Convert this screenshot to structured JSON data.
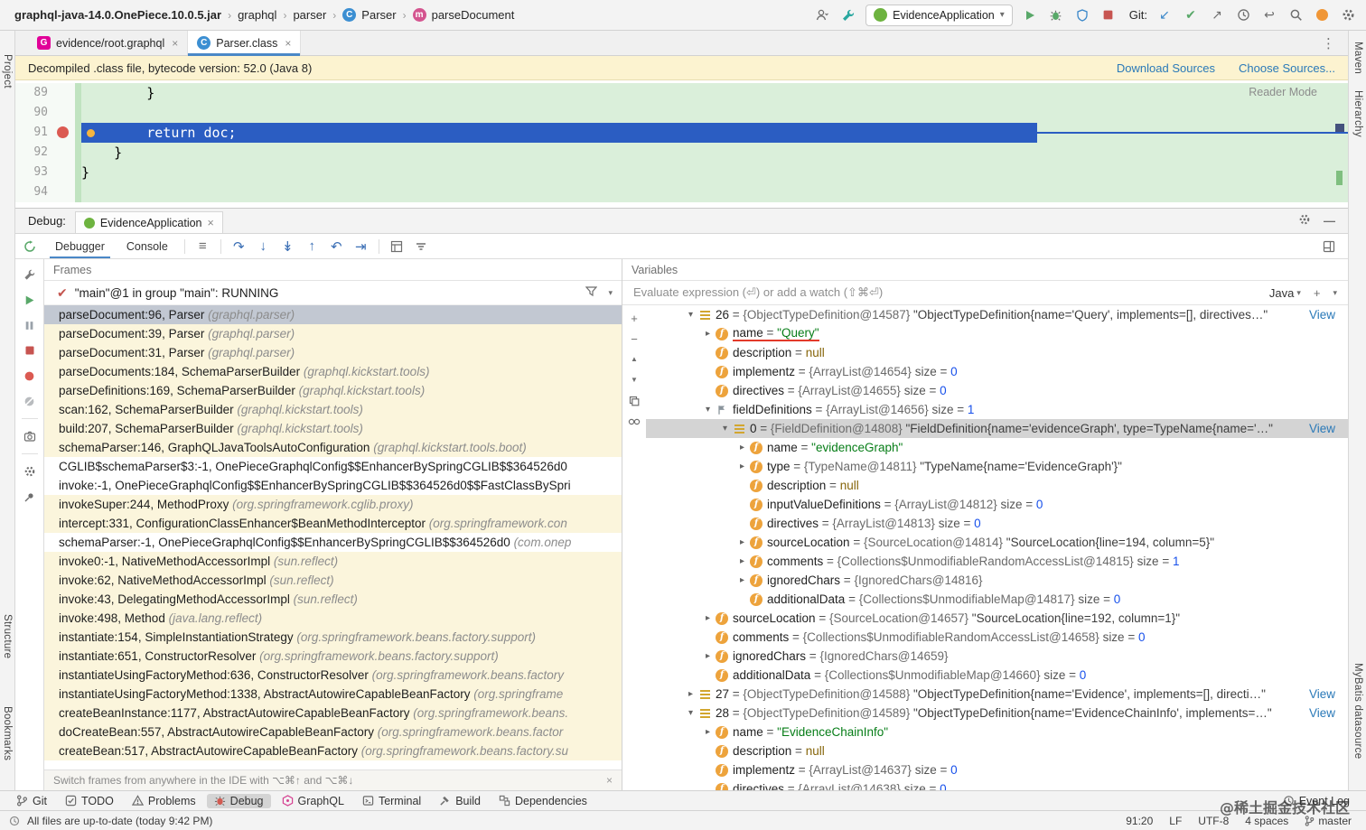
{
  "titlebar": {
    "breadcrumb": [
      {
        "label": "graphql-java-14.0.OnePiece.10.0.5.jar",
        "bold": true
      },
      {
        "label": "graphql"
      },
      {
        "label": "parser"
      },
      {
        "label": "Parser",
        "icon": "class-icon"
      },
      {
        "label": "parseDocument",
        "icon": "method-icon"
      }
    ],
    "run_config_label": "EvidenceApplication",
    "git_label": "Git:"
  },
  "editor_tabs": [
    {
      "label": "evidence/root.graphql",
      "icon": "graphql-file-icon",
      "active": false
    },
    {
      "label": "Parser.class",
      "icon": "class-icon",
      "active": true
    }
  ],
  "banner": {
    "message": "Decompiled .class file, bytecode version: 52.0 (Java 8)",
    "download_link": "Download Sources",
    "choose_link": "Choose Sources..."
  },
  "editor": {
    "reader_mode_label": "Reader Mode",
    "lines": [
      {
        "num": "89",
        "code": "        }"
      },
      {
        "num": "90",
        "code": ""
      },
      {
        "num": "91",
        "code": "        return doc;",
        "exec": true,
        "breakpoint": true
      },
      {
        "num": "92",
        "code": "    }"
      },
      {
        "num": "93",
        "code": "}"
      },
      {
        "num": "94",
        "code": ""
      }
    ]
  },
  "debug": {
    "panel_label": "Debug:",
    "session_tab_label": "EvidenceApplication",
    "tabs": [
      {
        "label": "Debugger",
        "active": true
      },
      {
        "label": "Console",
        "active": false
      }
    ],
    "frames": {
      "title": "Frames",
      "thread_label": "\"main\"@1 in group \"main\": RUNNING",
      "hint": "Switch frames from anywhere in the IDE with ⌥⌘↑ and ⌥⌘↓",
      "items": [
        {
          "text": "parseDocument:96, Parser",
          "pkg": "(graphql.parser)",
          "selected": true
        },
        {
          "text": "parseDocument:39, Parser",
          "pkg": "(graphql.parser)"
        },
        {
          "text": "parseDocument:31, Parser",
          "pkg": "(graphql.parser)"
        },
        {
          "text": "parseDocuments:184, SchemaParserBuilder",
          "pkg": "(graphql.kickstart.tools)"
        },
        {
          "text": "parseDefinitions:169, SchemaParserBuilder",
          "pkg": "(graphql.kickstart.tools)"
        },
        {
          "text": "scan:162, SchemaParserBuilder",
          "pkg": "(graphql.kickstart.tools)"
        },
        {
          "text": "build:207, SchemaParserBuilder",
          "pkg": "(graphql.kickstart.tools)"
        },
        {
          "text": "schemaParser:146, GraphQLJavaToolsAutoConfiguration",
          "pkg": "(graphql.kickstart.tools.boot)"
        },
        {
          "text": "CGLIB$schemaParser$3:-1, OnePieceGraphqlConfig$$EnhancerBySpringCGLIB$$364526d0",
          "pkg": "",
          "project": true
        },
        {
          "text": "invoke:-1, OnePieceGraphqlConfig$$EnhancerBySpringCGLIB$$364526d0$$FastClassBySpri",
          "pkg": "",
          "project": true
        },
        {
          "text": "invokeSuper:244, MethodProxy",
          "pkg": "(org.springframework.cglib.proxy)"
        },
        {
          "text": "intercept:331, ConfigurationClassEnhancer$BeanMethodInterceptor",
          "pkg": "(org.springframework.con"
        },
        {
          "text": "schemaParser:-1, OnePieceGraphqlConfig$$EnhancerBySpringCGLIB$$364526d0",
          "pkg": "(com.onep",
          "project": true
        },
        {
          "text": "invoke0:-1, NativeMethodAccessorImpl",
          "pkg": "(sun.reflect)"
        },
        {
          "text": "invoke:62, NativeMethodAccessorImpl",
          "pkg": "(sun.reflect)"
        },
        {
          "text": "invoke:43, DelegatingMethodAccessorImpl",
          "pkg": "(sun.reflect)"
        },
        {
          "text": "invoke:498, Method",
          "pkg": "(java.lang.reflect)"
        },
        {
          "text": "instantiate:154, SimpleInstantiationStrategy",
          "pkg": "(org.springframework.beans.factory.support)"
        },
        {
          "text": "instantiate:651, ConstructorResolver",
          "pkg": "(org.springframework.beans.factory.support)"
        },
        {
          "text": "instantiateUsingFactoryMethod:636, ConstructorResolver",
          "pkg": "(org.springframework.beans.factory"
        },
        {
          "text": "instantiateUsingFactoryMethod:1338, AbstractAutowireCapableBeanFactory",
          "pkg": "(org.springframe"
        },
        {
          "text": "createBeanInstance:1177, AbstractAutowireCapableBeanFactory",
          "pkg": "(org.springframework.beans."
        },
        {
          "text": "doCreateBean:557, AbstractAutowireCapableBeanFactory",
          "pkg": "(org.springframework.beans.factor"
        },
        {
          "text": "createBean:517, AbstractAutowireCapableBeanFactory",
          "pkg": "(org.springframework.beans.factory.su"
        }
      ]
    },
    "variables": {
      "title": "Variables",
      "evaluate_placeholder": "Evaluate expression (⏎) or add a watch (⇧⌘⏎)",
      "language_selector": "Java",
      "rows": [
        {
          "lv": 1,
          "ch": "v",
          "ic": "array-item-icon",
          "view": "View",
          "segs": [
            {
              "t": "n",
              "v": "26"
            },
            {
              "t": "d",
              "v": " = "
            },
            {
              "t": "r",
              "v": "{ObjectTypeDefinition@14587} "
            },
            {
              "t": "p",
              "v": "\"ObjectTypeDefinition{name='Query', implements=[], directives…\""
            }
          ]
        },
        {
          "lv": 2,
          "ch": ">",
          "ic": "field-icon",
          "u": 1,
          "segs": [
            {
              "t": "n",
              "v": "name"
            },
            {
              "t": "d",
              "v": " = "
            },
            {
              "t": "s",
              "v": "\"Query\""
            }
          ]
        },
        {
          "lv": 2,
          "ch": "",
          "ic": "field-icon",
          "segs": [
            {
              "t": "n",
              "v": "description"
            },
            {
              "t": "d",
              "v": " = "
            },
            {
              "t": "z",
              "v": "null"
            }
          ]
        },
        {
          "lv": 2,
          "ch": "",
          "ic": "field-icon",
          "segs": [
            {
              "t": "n",
              "v": "implementz"
            },
            {
              "t": "d",
              "v": " = "
            },
            {
              "t": "r",
              "v": "{ArrayList@14654} "
            },
            {
              "t": "d",
              "v": " size = "
            },
            {
              "t": "num",
              "v": "0"
            }
          ]
        },
        {
          "lv": 2,
          "ch": "",
          "ic": "field-icon",
          "segs": [
            {
              "t": "n",
              "v": "directives"
            },
            {
              "t": "d",
              "v": " = "
            },
            {
              "t": "r",
              "v": "{ArrayList@14655} "
            },
            {
              "t": "d",
              "v": " size = "
            },
            {
              "t": "num",
              "v": "0"
            }
          ]
        },
        {
          "lv": 2,
          "ch": "v",
          "ic": "flag-icon",
          "segs": [
            {
              "t": "n",
              "v": "fieldDefinitions"
            },
            {
              "t": "d",
              "v": " = "
            },
            {
              "t": "r",
              "v": "{ArrayList@14656} "
            },
            {
              "t": "d",
              "v": " size = "
            },
            {
              "t": "num",
              "v": "1"
            }
          ]
        },
        {
          "lv": 3,
          "ch": "v",
          "ic": "array-item-icon",
          "sel": 1,
          "view": "View",
          "segs": [
            {
              "t": "n",
              "v": "0"
            },
            {
              "t": "d",
              "v": " = "
            },
            {
              "t": "r",
              "v": "{FieldDefinition@14808} "
            },
            {
              "t": "p",
              "v": "\"FieldDefinition{name='evidenceGraph', type=TypeName{name='…\""
            }
          ]
        },
        {
          "lv": 4,
          "ch": ">",
          "ic": "field-icon",
          "segs": [
            {
              "t": "n",
              "v": "name"
            },
            {
              "t": "d",
              "v": " = "
            },
            {
              "t": "s",
              "v": "\"evidenceGraph\"",
              "u": 1
            }
          ]
        },
        {
          "lv": 4,
          "ch": ">",
          "ic": "field-icon",
          "segs": [
            {
              "t": "n",
              "v": "type"
            },
            {
              "t": "d",
              "v": " = "
            },
            {
              "t": "r",
              "v": "{TypeName@14811} "
            },
            {
              "t": "p",
              "v": "\"TypeName{name='EvidenceGraph'}\""
            }
          ]
        },
        {
          "lv": 4,
          "ch": "",
          "ic": "field-icon",
          "segs": [
            {
              "t": "n",
              "v": "description"
            },
            {
              "t": "d",
              "v": " = "
            },
            {
              "t": "z",
              "v": "null"
            }
          ]
        },
        {
          "lv": 4,
          "ch": "",
          "ic": "field-icon",
          "segs": [
            {
              "t": "n",
              "v": "inputValueDefinitions"
            },
            {
              "t": "d",
              "v": " = "
            },
            {
              "t": "r",
              "v": "{ArrayList@14812} "
            },
            {
              "t": "d",
              "v": " size = "
            },
            {
              "t": "num",
              "v": "0"
            }
          ]
        },
        {
          "lv": 4,
          "ch": "",
          "ic": "field-icon",
          "segs": [
            {
              "t": "n",
              "v": "directives"
            },
            {
              "t": "d",
              "v": " = "
            },
            {
              "t": "r",
              "v": "{ArrayList@14813} "
            },
            {
              "t": "d",
              "v": " size = "
            },
            {
              "t": "num",
              "v": "0"
            }
          ]
        },
        {
          "lv": 4,
          "ch": ">",
          "ic": "field-icon",
          "segs": [
            {
              "t": "n",
              "v": "sourceLocation"
            },
            {
              "t": "d",
              "v": " = "
            },
            {
              "t": "r",
              "v": "{SourceLocation@14814} "
            },
            {
              "t": "p",
              "v": "\"SourceLocation{line=194, column=5}\""
            }
          ]
        },
        {
          "lv": 4,
          "ch": ">",
          "ic": "field-icon",
          "segs": [
            {
              "t": "n",
              "v": "comments"
            },
            {
              "t": "d",
              "v": " = "
            },
            {
              "t": "r",
              "v": "{Collections$UnmodifiableRandomAccessList@14815} "
            },
            {
              "t": "d",
              "v": " size = "
            },
            {
              "t": "num",
              "v": "1"
            }
          ]
        },
        {
          "lv": 4,
          "ch": ">",
          "ic": "field-icon",
          "segs": [
            {
              "t": "n",
              "v": "ignoredChars"
            },
            {
              "t": "d",
              "v": " = "
            },
            {
              "t": "r",
              "v": "{IgnoredChars@14816}"
            }
          ]
        },
        {
          "lv": 4,
          "ch": "",
          "ic": "field-icon",
          "segs": [
            {
              "t": "n",
              "v": "additionalData"
            },
            {
              "t": "d",
              "v": " = "
            },
            {
              "t": "r",
              "v": "{Collections$UnmodifiableMap@14817} "
            },
            {
              "t": "d",
              "v": " size = "
            },
            {
              "t": "num",
              "v": "0"
            }
          ]
        },
        {
          "lv": 2,
          "ch": ">",
          "ic": "field-icon",
          "segs": [
            {
              "t": "n",
              "v": "sourceLocation"
            },
            {
              "t": "d",
              "v": " = "
            },
            {
              "t": "r",
              "v": "{SourceLocation@14657} "
            },
            {
              "t": "p",
              "v": "\"SourceLocation{line=192, column=1}\""
            }
          ]
        },
        {
          "lv": 2,
          "ch": "",
          "ic": "field-icon",
          "segs": [
            {
              "t": "n",
              "v": "comments"
            },
            {
              "t": "d",
              "v": " = "
            },
            {
              "t": "r",
              "v": "{Collections$UnmodifiableRandomAccessList@14658} "
            },
            {
              "t": "d",
              "v": " size = "
            },
            {
              "t": "num",
              "v": "0"
            }
          ]
        },
        {
          "lv": 2,
          "ch": ">",
          "ic": "field-icon",
          "segs": [
            {
              "t": "n",
              "v": "ignoredChars"
            },
            {
              "t": "d",
              "v": " = "
            },
            {
              "t": "r",
              "v": "{IgnoredChars@14659}"
            }
          ]
        },
        {
          "lv": 2,
          "ch": "",
          "ic": "field-icon",
          "segs": [
            {
              "t": "n",
              "v": "additionalData"
            },
            {
              "t": "d",
              "v": " = "
            },
            {
              "t": "r",
              "v": "{Collections$UnmodifiableMap@14660} "
            },
            {
              "t": "d",
              "v": " size = "
            },
            {
              "t": "num",
              "v": "0"
            }
          ]
        },
        {
          "lv": 1,
          "ch": ">",
          "ic": "array-item-icon",
          "view": "View",
          "segs": [
            {
              "t": "n",
              "v": "27"
            },
            {
              "t": "d",
              "v": " = "
            },
            {
              "t": "r",
              "v": "{ObjectTypeDefinition@14588} "
            },
            {
              "t": "p",
              "v": "\"ObjectTypeDefinition{name='Evidence', implements=[], directi…\""
            }
          ]
        },
        {
          "lv": 1,
          "ch": "v",
          "ic": "array-item-icon",
          "view": "View",
          "segs": [
            {
              "t": "n",
              "v": "28"
            },
            {
              "t": "d",
              "v": " = "
            },
            {
              "t": "r",
              "v": "{ObjectTypeDefinition@14589} "
            },
            {
              "t": "p",
              "v": "\"ObjectTypeDefinition{name='EvidenceChainInfo', implements=…\""
            }
          ]
        },
        {
          "lv": 2,
          "ch": ">",
          "ic": "field-icon",
          "segs": [
            {
              "t": "n",
              "v": "name"
            },
            {
              "t": "d",
              "v": " = "
            },
            {
              "t": "s",
              "v": "\"EvidenceChainInfo\""
            }
          ]
        },
        {
          "lv": 2,
          "ch": "",
          "ic": "field-icon",
          "segs": [
            {
              "t": "n",
              "v": "description"
            },
            {
              "t": "d",
              "v": " = "
            },
            {
              "t": "z",
              "v": "null"
            }
          ]
        },
        {
          "lv": 2,
          "ch": "",
          "ic": "field-icon",
          "segs": [
            {
              "t": "n",
              "v": "implementz"
            },
            {
              "t": "d",
              "v": " = "
            },
            {
              "t": "r",
              "v": "{ArrayList@14637} "
            },
            {
              "t": "d",
              "v": " size = "
            },
            {
              "t": "num",
              "v": "0"
            }
          ]
        },
        {
          "lv": 2,
          "ch": "",
          "ic": "field-icon",
          "segs": [
            {
              "t": "n",
              "v": "directives"
            },
            {
              "t": "d",
              "v": " = "
            },
            {
              "t": "r",
              "v": "{ArrayList@14638} "
            },
            {
              "t": "d",
              "v": " size = "
            },
            {
              "t": "num",
              "v": "0"
            }
          ]
        }
      ]
    }
  },
  "tool_buttons": [
    {
      "label": "Git",
      "icon": "git-icon"
    },
    {
      "label": "TODO",
      "icon": "todo-icon"
    },
    {
      "label": "Problems",
      "icon": "problems-icon"
    },
    {
      "label": "Debug",
      "icon": "debug-icon",
      "active": true
    },
    {
      "label": "GraphQL",
      "icon": "graphql-tool-icon"
    },
    {
      "label": "Terminal",
      "icon": "terminal-icon"
    },
    {
      "label": "Build",
      "icon": "build-icon"
    },
    {
      "label": "Dependencies",
      "icon": "dependencies-icon"
    }
  ],
  "event_log_label": "Event Log",
  "statusbar": {
    "message": "All files are up-to-date (today 9:42 PM)",
    "position": "91:20",
    "line_ending": "LF",
    "encoding": "UTF-8",
    "indent": "4 spaces",
    "branch": "master"
  },
  "stripes": {
    "left_top": [
      "Project"
    ],
    "left_bottom": [
      "Structure",
      "Bookmarks"
    ],
    "right_top": [
      "Maven",
      "Hierarchy"
    ],
    "right_bottom": [
      "MyBatis datasource"
    ]
  },
  "watermark": "@稀土掘金技术社区",
  "colors": {
    "execution_line": "#2b5dc2",
    "decompiled_added_bg": "#daefda",
    "frame_library_bg": "#fbf5dc",
    "selection_gray": "#d4d4d4",
    "annotation_red": "#e33a2a",
    "link_blue": "#2a79b8",
    "string_green": "#067d17"
  }
}
